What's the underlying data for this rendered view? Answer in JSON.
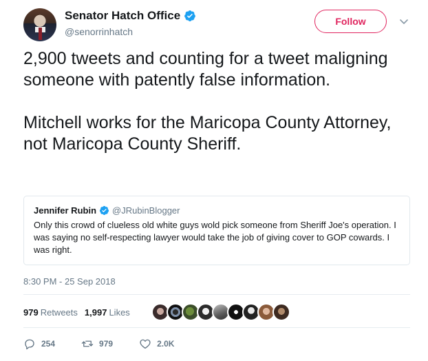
{
  "author": {
    "name": "Senator Hatch Office",
    "handle": "@senorrinhatch",
    "verified": true
  },
  "follow_label": "Follow",
  "tweet": {
    "text": "2,900 tweets and counting for a tweet maligning someone with patently false information.\n\nMitchell works for the Maricopa County Attorney, not Maricopa County Sheriff.",
    "timestamp": "8:30 PM - 25 Sep 2018"
  },
  "quoted": {
    "name": "Jennifer Rubin",
    "handle": "@JRubinBlogger",
    "verified": true,
    "text": "Only this crowd of clueless old white guys wold pick someone from Sheriff Joe's operation. I was saying no self-respecting lawyer would take the job of giving cover to GOP cowards. I was right."
  },
  "stats": {
    "retweets_count": "979",
    "retweets_label": "Retweets",
    "likes_count": "1,997",
    "likes_label": "Likes"
  },
  "liker_avatars": [
    "avatar-1",
    "avatar-2",
    "avatar-3",
    "avatar-4",
    "avatar-5",
    "avatar-6",
    "avatar-7",
    "avatar-8",
    "avatar-9"
  ],
  "actions": {
    "reply_count": "254",
    "retweet_count": "979",
    "like_count": "2.0K"
  },
  "colors": {
    "follow_accent": "#e0245e",
    "verified_blue": "#1da1f2",
    "muted_text": "#657786",
    "border": "#e1e8ed"
  }
}
